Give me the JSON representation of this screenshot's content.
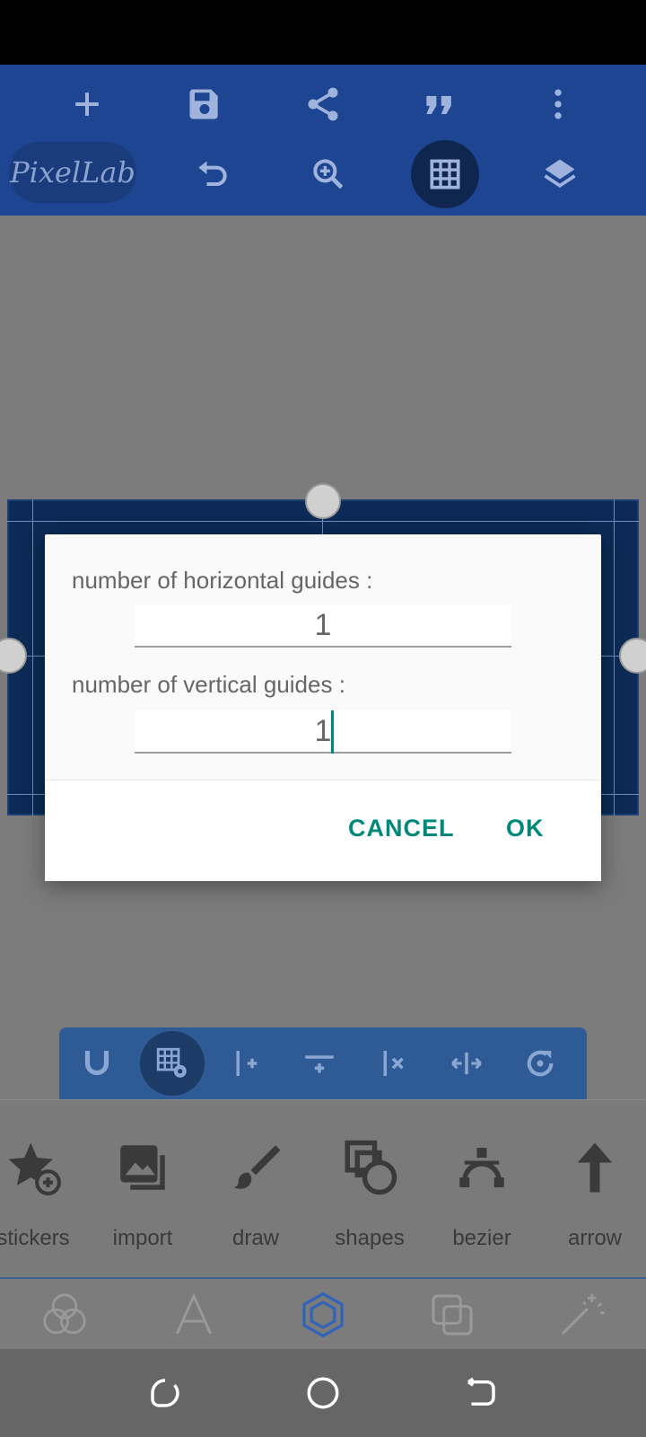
{
  "app": {
    "logo_text": "PixelLab",
    "accent_color": "#1e4591",
    "dialog_accent": "#00897b"
  },
  "top_toolbar": {
    "row1": [
      "add-icon",
      "save-icon",
      "share-icon",
      "quote-icon",
      "more-vert-icon"
    ],
    "row2": [
      "undo-icon",
      "zoom-in-icon",
      "grid-icon",
      "layers-icon"
    ]
  },
  "dialog": {
    "horizontal_label": "number of horizontal guides :",
    "horizontal_value": "1",
    "vertical_label": "number of vertical guides :",
    "vertical_value": "1",
    "cancel_label": "CANCEL",
    "ok_label": "OK"
  },
  "guide_toolbar": {
    "icons": [
      "magnet-icon",
      "grid-settings-icon",
      "add-vertical-guide-icon",
      "add-horizontal-guide-icon",
      "remove-guide-icon",
      "center-guide-icon",
      "reset-icon"
    ]
  },
  "tools": [
    {
      "label": "stickers",
      "icon": "sticker-icon"
    },
    {
      "label": "import",
      "icon": "import-image-icon"
    },
    {
      "label": "draw",
      "icon": "brush-icon"
    },
    {
      "label": "shapes",
      "icon": "shapes-icon"
    },
    {
      "label": "bezier",
      "icon": "bezier-icon"
    },
    {
      "label": "arrow",
      "icon": "arrow-up-icon"
    }
  ],
  "tabs": [
    "blend-tab",
    "text-tab",
    "shape-tab",
    "layers-tab",
    "effects-tab"
  ],
  "nav": [
    "recents-icon",
    "home-icon",
    "back-icon"
  ]
}
